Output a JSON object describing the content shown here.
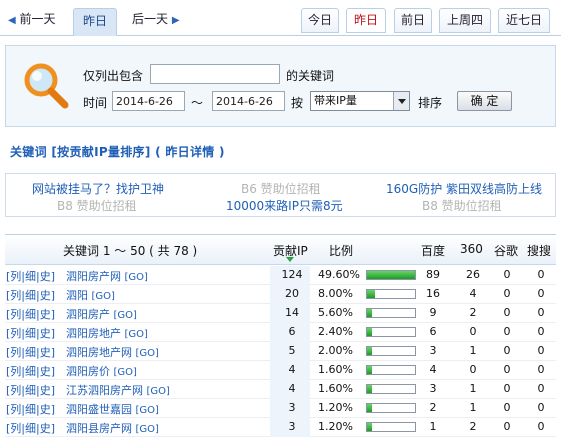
{
  "nav": {
    "prev_label": "前一天",
    "current_label": "昨日",
    "next_label": "后一天",
    "quick_tabs": [
      "今日",
      "昨日",
      "前日",
      "上周四",
      "近七日"
    ],
    "active_quick_tab": "昨日"
  },
  "filter": {
    "include_prefix": "仅列出包含",
    "include_value": "",
    "include_suffix": "的关键词",
    "time_label": "时间",
    "date_from": "2014-6-26",
    "range_sep": "～",
    "date_to": "2014-6-26",
    "by_label": "按",
    "sort_select": "带来IP量",
    "sort_label": "排序",
    "confirm_label": "确 定"
  },
  "heading": "关键词 [按贡献IP量排序] ( 昨日详情 )",
  "ads": {
    "row1": {
      "left": "网站被挂马了？找护卫神",
      "middle": "B6  赞助位招租",
      "right": "160G防护 紫田双线高防上线"
    },
    "row2": {
      "left": "B8  赞助位招租",
      "middle": "10000来路IP只需8元",
      "right": "B8  赞助位招租"
    }
  },
  "table": {
    "headers": {
      "keyword": "关键词 1 ～ 50 ( 共 78 )",
      "ip": "贡献IP",
      "ratio": "比例",
      "baidu": "百度",
      "s360": "360",
      "google": "谷歌",
      "sogou": "搜搜"
    },
    "row_links": [
      "[列|细|史]"
    ],
    "go_label": "[GO]",
    "rows": [
      {
        "kw": "泗阳房产网",
        "ip": "124",
        "ratio": "49.60%",
        "share": 0.496,
        "baidu": "89",
        "s360": "26",
        "google": "0",
        "sogou": "0"
      },
      {
        "kw": "泗阳",
        "ip": "20",
        "ratio": "8.00%",
        "share": 0.08,
        "baidu": "16",
        "s360": "4",
        "google": "0",
        "sogou": "0"
      },
      {
        "kw": "泗阳房产",
        "ip": "14",
        "ratio": "5.60%",
        "share": 0.056,
        "baidu": "9",
        "s360": "2",
        "google": "0",
        "sogou": "0"
      },
      {
        "kw": "泗阳房地产",
        "ip": "6",
        "ratio": "2.40%",
        "share": 0.024,
        "baidu": "6",
        "s360": "0",
        "google": "0",
        "sogou": "0"
      },
      {
        "kw": "泗阳房地产网",
        "ip": "5",
        "ratio": "2.00%",
        "share": 0.02,
        "baidu": "3",
        "s360": "1",
        "google": "0",
        "sogou": "0"
      },
      {
        "kw": "泗阳房价",
        "ip": "4",
        "ratio": "1.60%",
        "share": 0.016,
        "baidu": "4",
        "s360": "0",
        "google": "0",
        "sogou": "0"
      },
      {
        "kw": "江苏泗阳房产网",
        "ip": "4",
        "ratio": "1.60%",
        "share": 0.016,
        "baidu": "3",
        "s360": "1",
        "google": "0",
        "sogou": "0"
      },
      {
        "kw": "泗阳盛世嘉园",
        "ip": "3",
        "ratio": "1.20%",
        "share": 0.012,
        "baidu": "2",
        "s360": "1",
        "google": "0",
        "sogou": "0"
      },
      {
        "kw": "泗阳县房产网",
        "ip": "3",
        "ratio": "1.20%",
        "share": 0.012,
        "baidu": "1",
        "s360": "2",
        "google": "0",
        "sogou": "0"
      }
    ]
  },
  "colors": {
    "accent": "#1f5fb8",
    "active_tab": "#c0101a",
    "bar_fill": "#1f9a27"
  }
}
